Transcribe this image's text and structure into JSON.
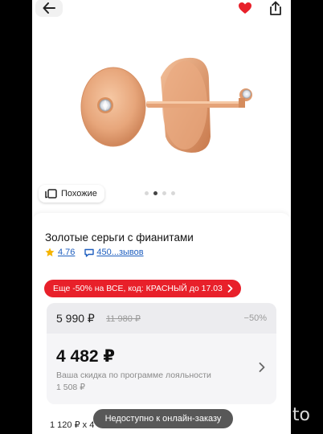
{
  "gallery": {
    "similar_label": "Похожие",
    "dots": 4,
    "active_dot": 2
  },
  "product": {
    "title": "Золотые серьги с фианитами",
    "rating": "4.76",
    "reviews": "450...зывов"
  },
  "promo": {
    "text": "Еще -50% на ВСЕ, код: КРАСНЫЙ до 17.03"
  },
  "pricing": {
    "old_price": "5 990 ₽",
    "crossed_price": "11 980 ₽",
    "discount": "−50%",
    "new_price": "4 482 ₽",
    "loyalty_text": "Ваша скидка по программе лояльности",
    "loyalty_amount": "1 508 ₽",
    "installment": "1 120 ₽ х 4"
  },
  "toast": {
    "text": "Недоступно к онлайн-заказу"
  },
  "watermark": {
    "text": "Avito"
  },
  "colors": {
    "accent_red": "#e8202a",
    "link_blue": "#1f5fbf",
    "gold": "#e7a67b"
  }
}
